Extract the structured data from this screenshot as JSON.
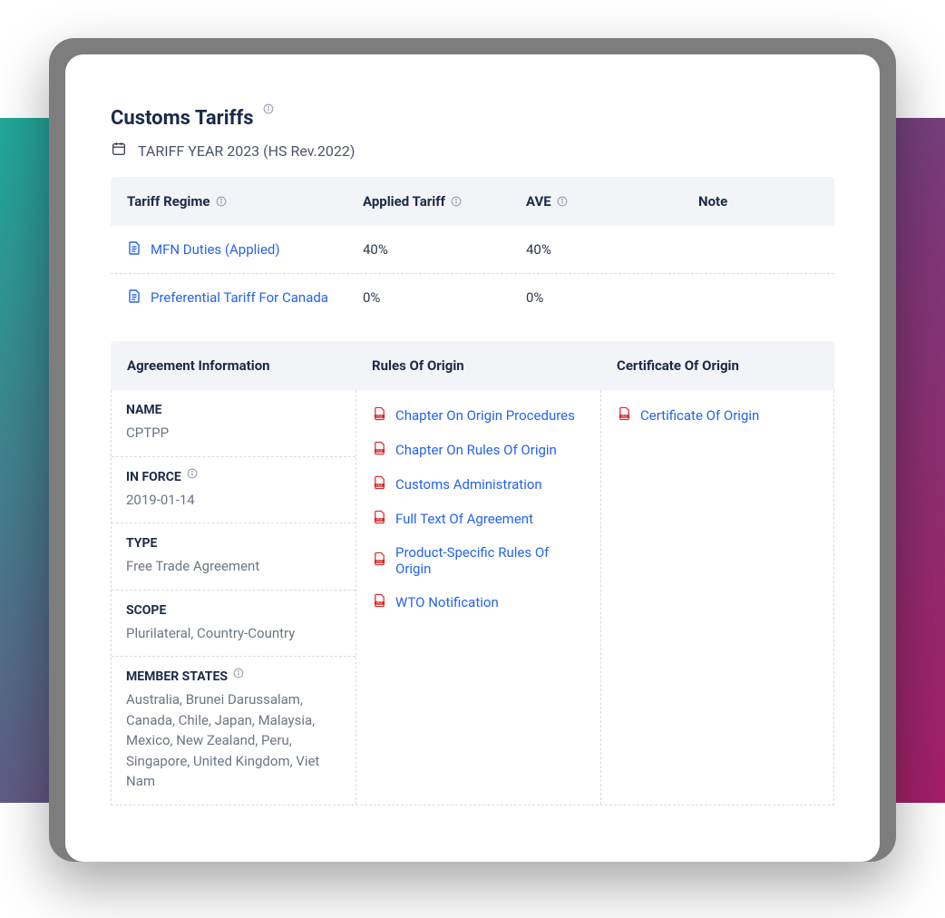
{
  "title": "Customs Tariffs",
  "subtitle": "TARIFF YEAR 2023 (HS Rev.2022)",
  "tariff_headers": {
    "regime": "Tariff Regime",
    "applied": "Applied Tariff",
    "ave": "AVE",
    "note": "Note"
  },
  "tariff_rows": [
    {
      "name": "MFN Duties (Applied)",
      "applied": "40%",
      "ave": "40%",
      "note": ""
    },
    {
      "name": "Preferential Tariff For Canada",
      "applied": "0%",
      "ave": "0%",
      "note": ""
    }
  ],
  "details_headers": {
    "agreement": "Agreement Information",
    "rules": "Rules Of Origin",
    "certificate": "Certificate Of Origin"
  },
  "agreement": {
    "name_label": "NAME",
    "name_value": "CPTPP",
    "inforce_label": "IN FORCE",
    "inforce_value": "2019-01-14",
    "type_label": "TYPE",
    "type_value": "Free Trade Agreement",
    "scope_label": "SCOPE",
    "scope_value": "Plurilateral, Country-Country",
    "members_label": "MEMBER STATES",
    "members_value": "Australia, Brunei Darussalam, Canada, Chile, Japan, Malaysia, Mexico, New Zealand, Peru, Singapore, United Kingdom, Viet Nam"
  },
  "rules_links": [
    "Chapter On Origin Procedures",
    "Chapter On Rules Of Origin",
    "Customs Administration",
    "Full Text Of Agreement",
    "Product-Specific Rules Of Origin",
    "WTO Notification"
  ],
  "certificate_links": [
    "Certificate Of Origin"
  ]
}
